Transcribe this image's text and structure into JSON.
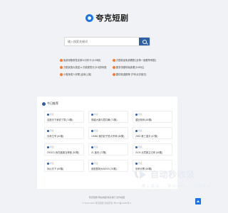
{
  "brand": {
    "name": "夸克短剧",
    "logo_icon": "quark-logo-icon"
  },
  "search": {
    "placeholder": "输入搜索关键词",
    "button_icon": "search-icon"
  },
  "hot_links": [
    {
      "label": "免费领取零售买家11分折卡 [0.05秒]"
    },
    {
      "label": "万剧精品免费看剧 [全场一键看所有剧]"
    },
    {
      "label": "万剧优惠大放送 ● 万能视觉分 [9.8]折特惠"
    },
    {
      "label": "剧多多剧场免费看 [5.89元]"
    },
    {
      "label": "小程序成人好看 [全库上架]"
    },
    {
      "label": "剧情精选推荐 [千年点评宝贝]"
    }
  ],
  "section": {
    "title": "今日推荐"
  },
  "cards": [
    {
      "meta": "夸克",
      "title": "这座天下我说了算 (74集)"
    },
    {
      "meta": "夸克",
      "title": "穿越大唐与君共舞 (71集)"
    },
    {
      "meta": "夸克",
      "title": "重回帝师 (80集)"
    },
    {
      "meta": "夸克",
      "title": "天命王爷 (61集)"
    },
    {
      "meta": "夸克",
      "title": "10086 我的妃子是大宗师 (80集)"
    },
    {
      "meta": "夸克",
      "title": "2053 第三重天 (67集)"
    },
    {
      "meta": "夸克",
      "title": "200221 我在盛唐当神医 (52集)"
    },
    {
      "meta": "夸克",
      "title": "21 盖世 (72集)"
    },
    {
      "meta": "夸克",
      "title": "2103 北境霸主归来 (60集)"
    },
    {
      "meta": "夸克",
      "title": "凤仪天下 (60集)"
    },
    {
      "meta": "夸克",
      "title": "我是剧场大BOSS (76集)"
    },
    {
      "meta": "夸克",
      "title": "剑来长歌 (80集)"
    }
  ],
  "footer": {
    "links": "夸克短剧  网站地图  联系我们  合作加盟",
    "copyright": "© 2018-2024 夸克短剧 版权所有 粤ICP备10086号-1"
  },
  "watermark": {
    "text": "自动秒收录",
    "sub": "散上链接 → 来访一次 → 自动收录"
  },
  "colors": {
    "accent": "#2f5ea9",
    "brand_blue": "#1a73e8",
    "hot": "#ff7a2f",
    "background": "#f0f2f5"
  },
  "back_to_top_icon": "arrow-up-icon"
}
